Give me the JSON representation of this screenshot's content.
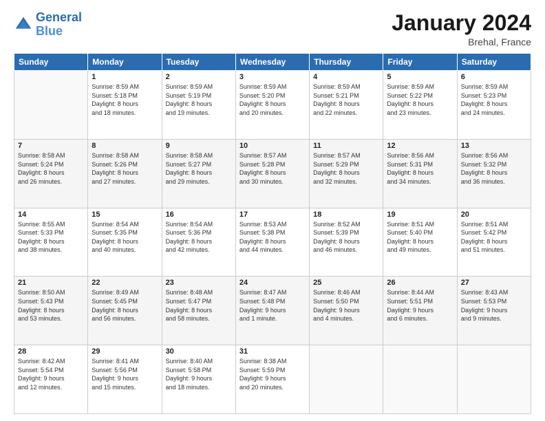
{
  "logo": {
    "line1": "General",
    "line2": "Blue"
  },
  "title": "January 2024",
  "location": "Brehal, France",
  "headers": [
    "Sunday",
    "Monday",
    "Tuesday",
    "Wednesday",
    "Thursday",
    "Friday",
    "Saturday"
  ],
  "weeks": [
    [
      {
        "day": "",
        "info": ""
      },
      {
        "day": "1",
        "info": "Sunrise: 8:59 AM\nSunset: 5:18 PM\nDaylight: 8 hours\nand 18 minutes."
      },
      {
        "day": "2",
        "info": "Sunrise: 8:59 AM\nSunset: 5:19 PM\nDaylight: 8 hours\nand 19 minutes."
      },
      {
        "day": "3",
        "info": "Sunrise: 8:59 AM\nSunset: 5:20 PM\nDaylight: 8 hours\nand 20 minutes."
      },
      {
        "day": "4",
        "info": "Sunrise: 8:59 AM\nSunset: 5:21 PM\nDaylight: 8 hours\nand 22 minutes."
      },
      {
        "day": "5",
        "info": "Sunrise: 8:59 AM\nSunset: 5:22 PM\nDaylight: 8 hours\nand 23 minutes."
      },
      {
        "day": "6",
        "info": "Sunrise: 8:59 AM\nSunset: 5:23 PM\nDaylight: 8 hours\nand 24 minutes."
      }
    ],
    [
      {
        "day": "7",
        "info": "Sunrise: 8:58 AM\nSunset: 5:24 PM\nDaylight: 8 hours\nand 26 minutes."
      },
      {
        "day": "8",
        "info": "Sunrise: 8:58 AM\nSunset: 5:26 PM\nDaylight: 8 hours\nand 27 minutes."
      },
      {
        "day": "9",
        "info": "Sunrise: 8:58 AM\nSunset: 5:27 PM\nDaylight: 8 hours\nand 29 minutes."
      },
      {
        "day": "10",
        "info": "Sunrise: 8:57 AM\nSunset: 5:28 PM\nDaylight: 8 hours\nand 30 minutes."
      },
      {
        "day": "11",
        "info": "Sunrise: 8:57 AM\nSunset: 5:29 PM\nDaylight: 8 hours\nand 32 minutes."
      },
      {
        "day": "12",
        "info": "Sunrise: 8:56 AM\nSunset: 5:31 PM\nDaylight: 8 hours\nand 34 minutes."
      },
      {
        "day": "13",
        "info": "Sunrise: 8:56 AM\nSunset: 5:32 PM\nDaylight: 8 hours\nand 36 minutes."
      }
    ],
    [
      {
        "day": "14",
        "info": "Sunrise: 8:55 AM\nSunset: 5:33 PM\nDaylight: 8 hours\nand 38 minutes."
      },
      {
        "day": "15",
        "info": "Sunrise: 8:54 AM\nSunset: 5:35 PM\nDaylight: 8 hours\nand 40 minutes."
      },
      {
        "day": "16",
        "info": "Sunrise: 8:54 AM\nSunset: 5:36 PM\nDaylight: 8 hours\nand 42 minutes."
      },
      {
        "day": "17",
        "info": "Sunrise: 8:53 AM\nSunset: 5:38 PM\nDaylight: 8 hours\nand 44 minutes."
      },
      {
        "day": "18",
        "info": "Sunrise: 8:52 AM\nSunset: 5:39 PM\nDaylight: 8 hours\nand 46 minutes."
      },
      {
        "day": "19",
        "info": "Sunrise: 8:51 AM\nSunset: 5:40 PM\nDaylight: 8 hours\nand 49 minutes."
      },
      {
        "day": "20",
        "info": "Sunrise: 8:51 AM\nSunset: 5:42 PM\nDaylight: 8 hours\nand 51 minutes."
      }
    ],
    [
      {
        "day": "21",
        "info": "Sunrise: 8:50 AM\nSunset: 5:43 PM\nDaylight: 8 hours\nand 53 minutes."
      },
      {
        "day": "22",
        "info": "Sunrise: 8:49 AM\nSunset: 5:45 PM\nDaylight: 8 hours\nand 56 minutes."
      },
      {
        "day": "23",
        "info": "Sunrise: 8:48 AM\nSunset: 5:47 PM\nDaylight: 8 hours\nand 58 minutes."
      },
      {
        "day": "24",
        "info": "Sunrise: 8:47 AM\nSunset: 5:48 PM\nDaylight: 9 hours\nand 1 minute."
      },
      {
        "day": "25",
        "info": "Sunrise: 8:46 AM\nSunset: 5:50 PM\nDaylight: 9 hours\nand 4 minutes."
      },
      {
        "day": "26",
        "info": "Sunrise: 8:44 AM\nSunset: 5:51 PM\nDaylight: 9 hours\nand 6 minutes."
      },
      {
        "day": "27",
        "info": "Sunrise: 8:43 AM\nSunset: 5:53 PM\nDaylight: 9 hours\nand 9 minutes."
      }
    ],
    [
      {
        "day": "28",
        "info": "Sunrise: 8:42 AM\nSunset: 5:54 PM\nDaylight: 9 hours\nand 12 minutes."
      },
      {
        "day": "29",
        "info": "Sunrise: 8:41 AM\nSunset: 5:56 PM\nDaylight: 9 hours\nand 15 minutes."
      },
      {
        "day": "30",
        "info": "Sunrise: 8:40 AM\nSunset: 5:58 PM\nDaylight: 9 hours\nand 18 minutes."
      },
      {
        "day": "31",
        "info": "Sunrise: 8:38 AM\nSunset: 5:59 PM\nDaylight: 9 hours\nand 20 minutes."
      },
      {
        "day": "",
        "info": ""
      },
      {
        "day": "",
        "info": ""
      },
      {
        "day": "",
        "info": ""
      }
    ]
  ]
}
